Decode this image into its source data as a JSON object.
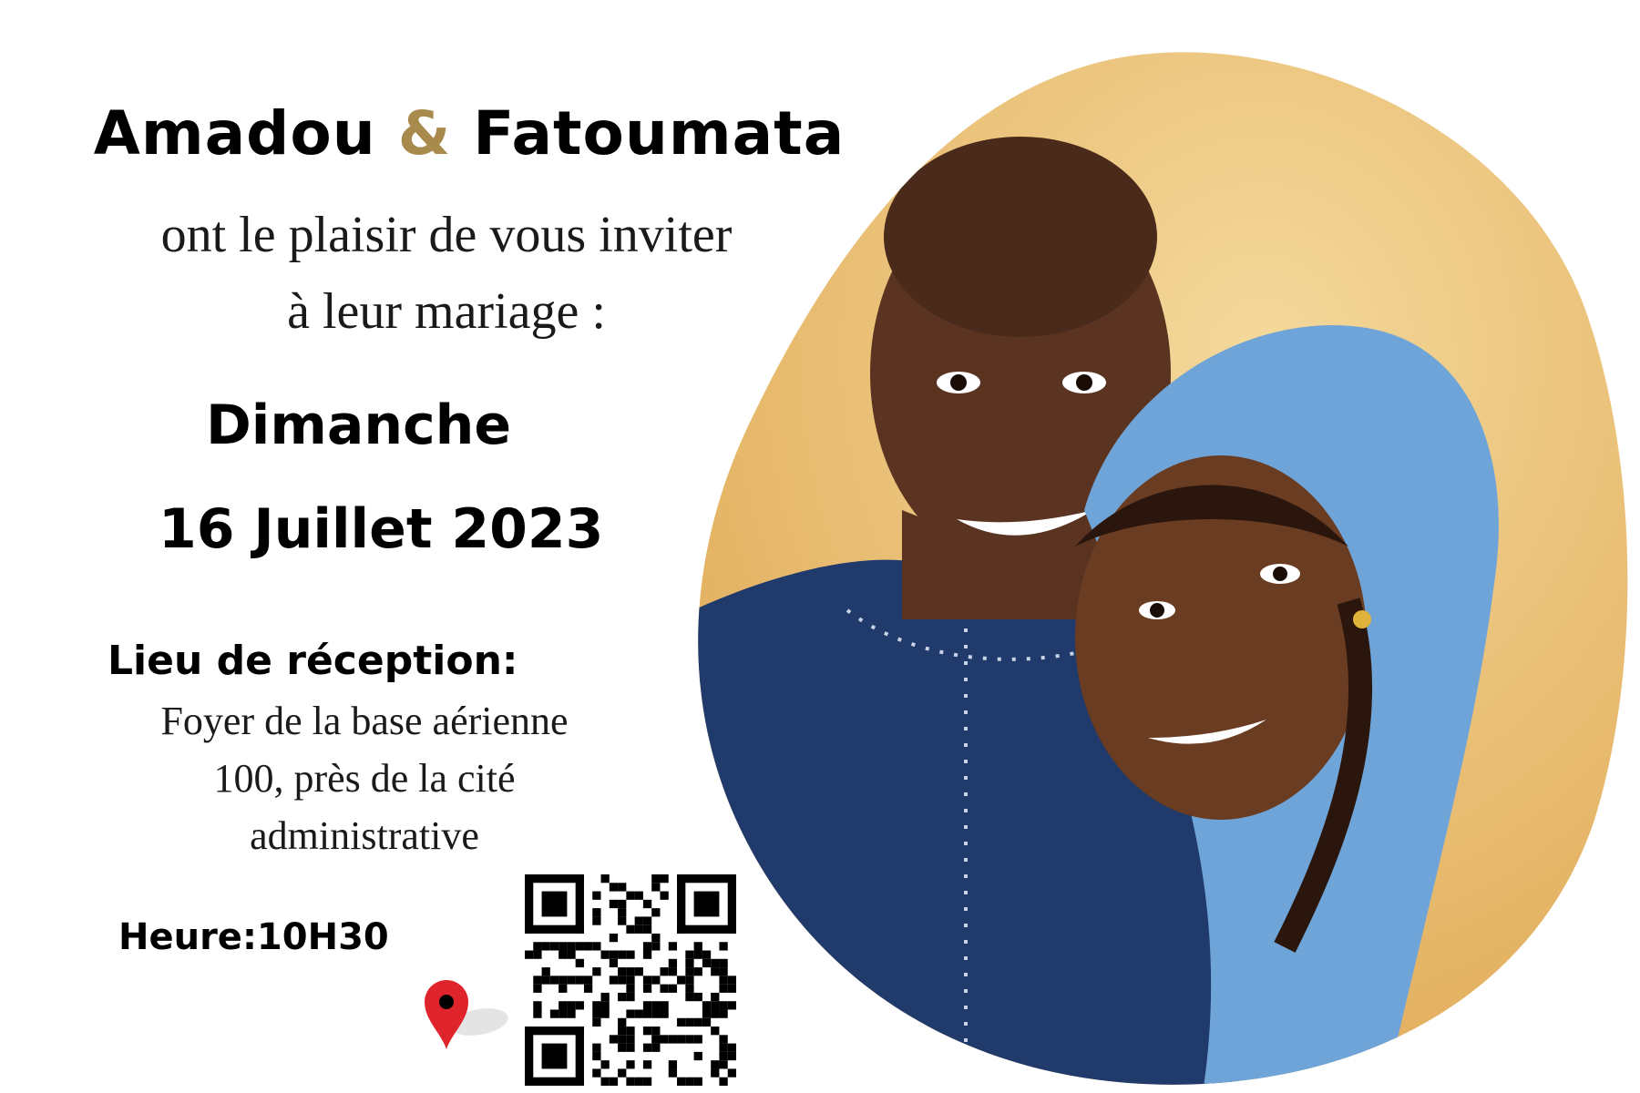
{
  "invitation": {
    "name1": "Amadou",
    "ampersand": "&",
    "name2": "Fatoumata",
    "line1": "ont le plaisir de vous inviter",
    "line2": "à leur mariage :",
    "day": "Dimanche",
    "date": "16 Juillet 2023",
    "venue_label": "Lieu de réception:",
    "venue_lines": [
      "Foyer de la base aérienne",
      "100, près de la cité",
      "administrative"
    ],
    "time": "Heure:10H30"
  },
  "colors": {
    "accent": "#a88a4c",
    "wall": "#e9b96a",
    "shirt": "#1f3a6b",
    "scarf": "#6fa4d8",
    "pin": "#e0242b"
  },
  "icons": [
    "map-pin-icon",
    "qr-code"
  ]
}
